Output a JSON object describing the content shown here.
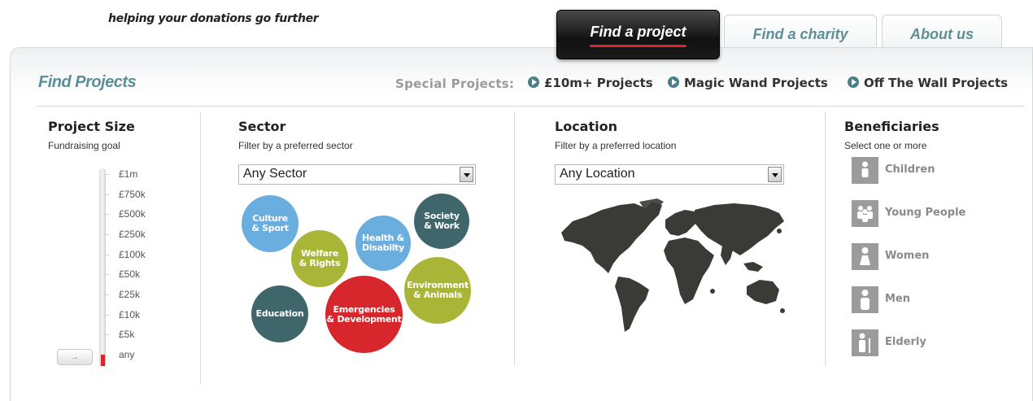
{
  "header": {
    "tagline": "helping your donations go further",
    "tabs": [
      {
        "label": "Find a project",
        "active": true
      },
      {
        "label": "Find a charity",
        "active": false
      },
      {
        "label": "About us",
        "active": false
      }
    ]
  },
  "page": {
    "title": "Find Projects",
    "special_label": "Special Projects:",
    "special_links": [
      "£10m+ Projects",
      "Magic Wand Projects",
      "Off The Wall Projects"
    ]
  },
  "project_size": {
    "title": "Project Size",
    "subtitle": "Fundraising goal",
    "levels": [
      "£1m",
      "£750k",
      "£500k",
      "£250k",
      "£100k",
      "£50k",
      "£25k",
      "£10k",
      "£5k",
      "any"
    ],
    "selected": "any"
  },
  "sector": {
    "title": "Sector",
    "subtitle": "Filter by a preferred sector",
    "select_value": "Any Sector",
    "bubbles": [
      {
        "label": "Culture\n& Sport",
        "color": "#6aaee0"
      },
      {
        "label": "Welfare\n& Rights",
        "color": "#a8b536"
      },
      {
        "label": "Health &\nDisabilty",
        "color": "#6aaee0"
      },
      {
        "label": "Society\n& Work",
        "color": "#3f676b"
      },
      {
        "label": "Environment\n& Animals",
        "color": "#a8b536"
      },
      {
        "label": "Emergencies\n& Development",
        "color": "#d7262c"
      },
      {
        "label": "Education",
        "color": "#3f676b"
      }
    ]
  },
  "location": {
    "title": "Location",
    "subtitle": "Filter by a preferred location",
    "select_value": "Any Location"
  },
  "beneficiaries": {
    "title": "Beneficiaries",
    "subtitle": "Select one or more",
    "items": [
      "Children",
      "Young People",
      "Women",
      "Men",
      "Elderly"
    ]
  },
  "colors": {
    "accent_teal": "#5a8f97",
    "accent_red": "#d7262c",
    "map": "#3a3a37"
  }
}
